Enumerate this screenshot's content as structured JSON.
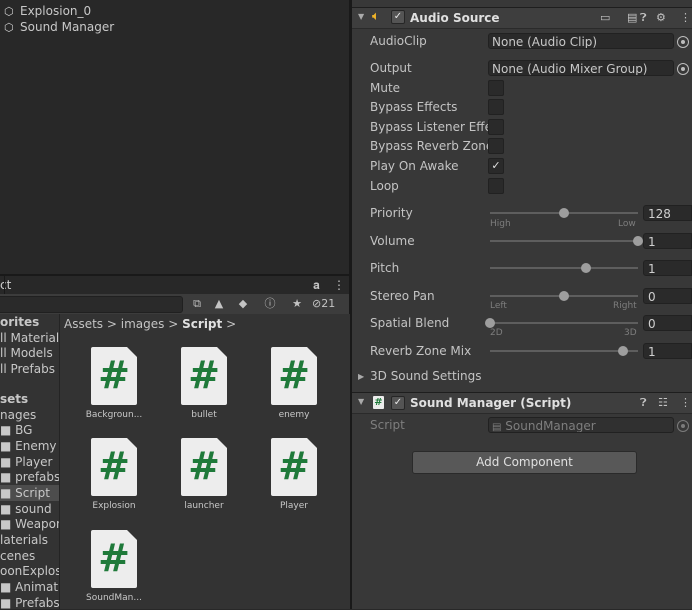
{
  "hierarchy": {
    "items": [
      {
        "label": "Explosion_0"
      },
      {
        "label": "Sound Manager"
      }
    ]
  },
  "project": {
    "tab_label": "ct",
    "toolbar": {
      "filter_count": "21"
    },
    "tree": [
      {
        "label": "orites",
        "bold": true
      },
      {
        "label": "ll Materials"
      },
      {
        "label": "ll Models"
      },
      {
        "label": "ll Prefabs"
      },
      {
        "label": "sets",
        "bold": true
      },
      {
        "label": "nages"
      },
      {
        "label": "■ BG"
      },
      {
        "label": "■ Enemy"
      },
      {
        "label": "■ Player"
      },
      {
        "label": "■ prefabs"
      },
      {
        "label": "■ Script"
      },
      {
        "label": "■ sound"
      },
      {
        "label": "■ Weapon"
      },
      {
        "label": "laterials"
      },
      {
        "label": "cenes"
      },
      {
        "label": "oonExplosi"
      },
      {
        "label": "■ Animatior"
      },
      {
        "label": "■ Prefabs"
      }
    ],
    "breadcrumb": {
      "part1": "Assets",
      "sep1": ">",
      "part2": "images",
      "sep2": ">",
      "part3": "Script",
      "sep3": ">"
    },
    "assets": [
      {
        "name": "Backgroun..."
      },
      {
        "name": "bullet"
      },
      {
        "name": "enemy"
      },
      {
        "name": "Explosion"
      },
      {
        "name": "launcher"
      },
      {
        "name": "Player"
      },
      {
        "name": "SoundMan..."
      }
    ]
  },
  "inspector": {
    "audio_source": {
      "title": "Audio Source",
      "enabled": true,
      "audioclip_label": "AudioClip",
      "audioclip_value": "None (Audio Clip)",
      "output_label": "Output",
      "output_value": "None (Audio Mixer Group)",
      "mute_label": "Mute",
      "bypass_effects_label": "Bypass Effects",
      "bypass_listener_label": "Bypass Listener Effec",
      "bypass_reverb_label": "Bypass Reverb Zones",
      "play_on_awake_label": "Play On Awake",
      "play_on_awake": true,
      "loop_label": "Loop",
      "priority_label": "Priority",
      "priority_value": "128",
      "priority_fraction": 0.5,
      "priority_hint_left": "High",
      "priority_hint_right": "Low",
      "volume_label": "Volume",
      "volume_value": "1",
      "volume_fraction": 1.0,
      "pitch_label": "Pitch",
      "pitch_value": "1",
      "pitch_fraction": 0.65,
      "stereo_pan_label": "Stereo Pan",
      "stereo_pan_value": "0",
      "stereo_pan_fraction": 0.5,
      "stereo_hint_left": "Left",
      "stereo_hint_right": "Right",
      "spatial_blend_label": "Spatial Blend",
      "spatial_blend_value": "0",
      "spatial_blend_fraction": 0.0,
      "spatial_hint_left": "2D",
      "spatial_hint_right": "3D",
      "reverb_mix_label": "Reverb Zone Mix",
      "reverb_mix_value": "1",
      "reverb_mix_fraction": 0.9,
      "sound3d_label": "3D Sound Settings"
    },
    "sound_manager": {
      "title": "Sound Manager (Script)",
      "enabled": true,
      "script_label": "Script",
      "script_value": "SoundManager"
    },
    "add_component_label": "Add Component"
  },
  "colors": {
    "panel_bg": "#282828",
    "inspector_bg": "#383838",
    "script_green": "#1f7a3a",
    "audio_icon": "#f0b429"
  }
}
